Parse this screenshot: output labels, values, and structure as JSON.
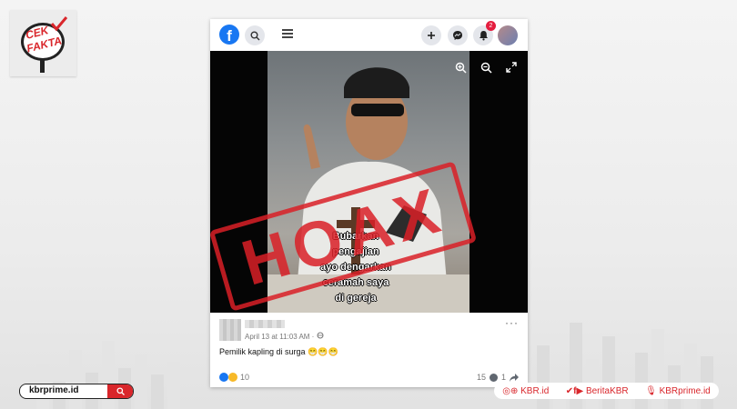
{
  "logo": {
    "line1": "CEK",
    "line2": "FAKTA"
  },
  "facebook": {
    "brand_letter": "f",
    "notification_count": "2",
    "photo_caption": [
      "Bubarkan",
      "pengajian",
      "ayo dengarkan",
      "ceramah saya",
      "di gereja"
    ],
    "stamp": "HOAX",
    "post": {
      "date": "April 13 at 11:03 AM · ",
      "text": "Pemilik kapling di surga 😁😁😁",
      "reactions_count": "10",
      "comments_count": "15",
      "shares_count": "1"
    }
  },
  "footer": {
    "url": "kbrprime.id",
    "social_1": "KBR.id",
    "social_2": "BeritaKBR",
    "social_3": "KBRprime.id"
  },
  "colors": {
    "brand_red": "#d9262b",
    "facebook_blue": "#1877f2"
  }
}
